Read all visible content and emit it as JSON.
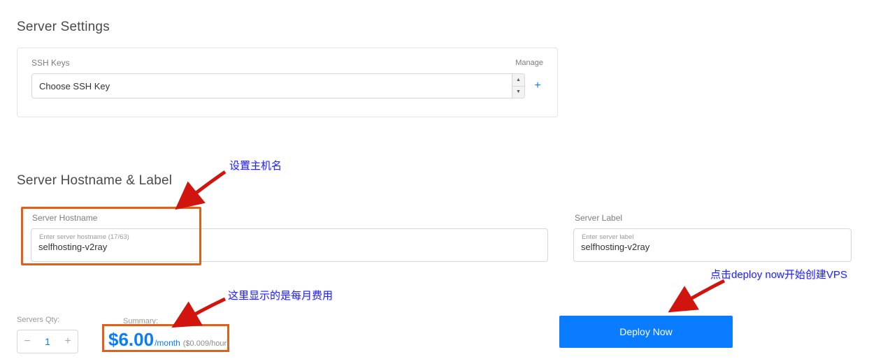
{
  "sections": {
    "server_settings_title": "Server Settings",
    "hostname_title": "Server Hostname & Label"
  },
  "ssh": {
    "label": "SSH Keys",
    "manage": "Manage",
    "selected": "Choose SSH Key"
  },
  "hostname": {
    "label": "Server Hostname",
    "float_label": "Enter server hostname (17/63)",
    "value": "selfhosting-v2ray"
  },
  "server_label": {
    "label": "Server Label",
    "float_label": "Enter server label",
    "value": "selfhosting-v2ray"
  },
  "qty": {
    "label": "Servers Qty:",
    "value": "1"
  },
  "summary": {
    "label": "Summary:",
    "price": "$6.00",
    "period": "/month",
    "hourly": "($0.009/hour)"
  },
  "deploy_label": "Deploy Now",
  "annotations": {
    "hostname_note": "设置主机名",
    "price_note": "这里显示的是每月费用",
    "deploy_note": "点击deploy now开始创建VPS"
  }
}
